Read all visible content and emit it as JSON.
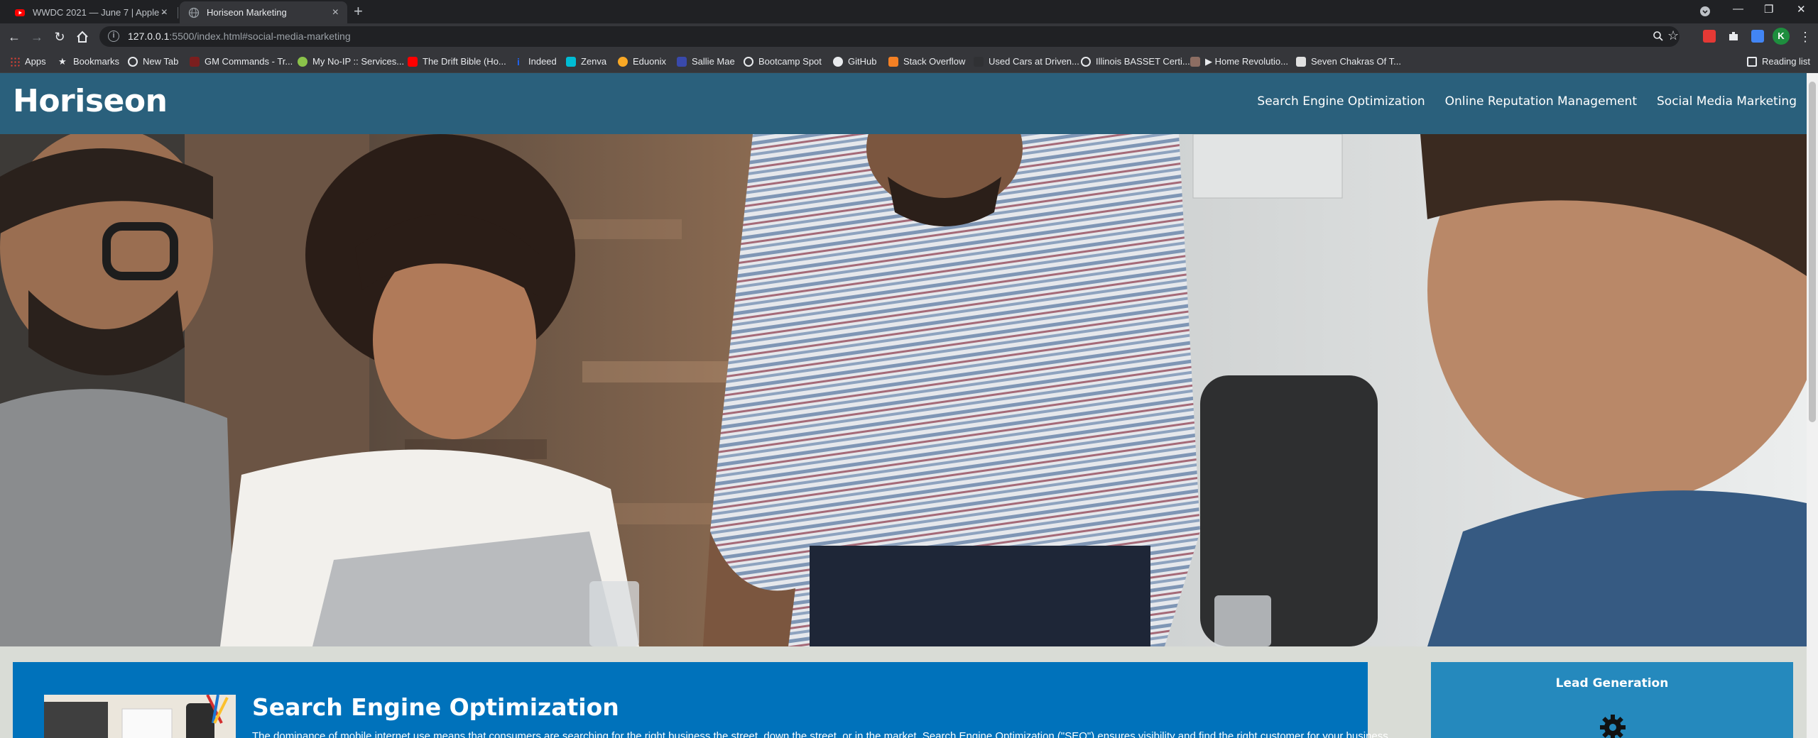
{
  "browser": {
    "tabs": [
      {
        "title": "WWDC 2021 — June 7 | Apple -",
        "active": false,
        "favicon": "youtube-icon"
      },
      {
        "title": "Horiseon Marketing",
        "active": true,
        "favicon": "globe-icon"
      }
    ],
    "url_host": "127.0.0.1",
    "url_rest": ":5500/index.html#social-media-marketing",
    "profile_initial": "K",
    "bookmarks": [
      "Apps",
      "Bookmarks",
      "New Tab",
      "GM Commands - Tr...",
      "My No-IP :: Services...",
      "The Drift Bible (Ho...",
      "Indeed",
      "Zenva",
      "Eduonix",
      "Sallie Mae",
      "Bootcamp Spot",
      "GitHub",
      "Stack Overflow",
      "Used Cars at Driven...",
      "Illinois BASSET Certi...",
      "▶ Home Revolutio...",
      "Seven Chakras Of T..."
    ],
    "reading_list": "Reading list"
  },
  "site": {
    "logo": "Horiseon",
    "nav": [
      "Search Engine Optimization",
      "Online Reputation Management",
      "Social Media Marketing"
    ],
    "section_title": "Search Engine Optimization",
    "section_text": "The dominance of mobile internet use means that consumers are searching for the right business the street, down the street, or in the market. Search Engine Optimization (\"SEO\") ensures visibility and find the right customer for your business",
    "aside_title": "Lead Generation"
  },
  "colors": {
    "header": "#2a607c",
    "content": "#0072bb",
    "aside": "#2589bd",
    "page_bg": "#d9dcd6"
  }
}
